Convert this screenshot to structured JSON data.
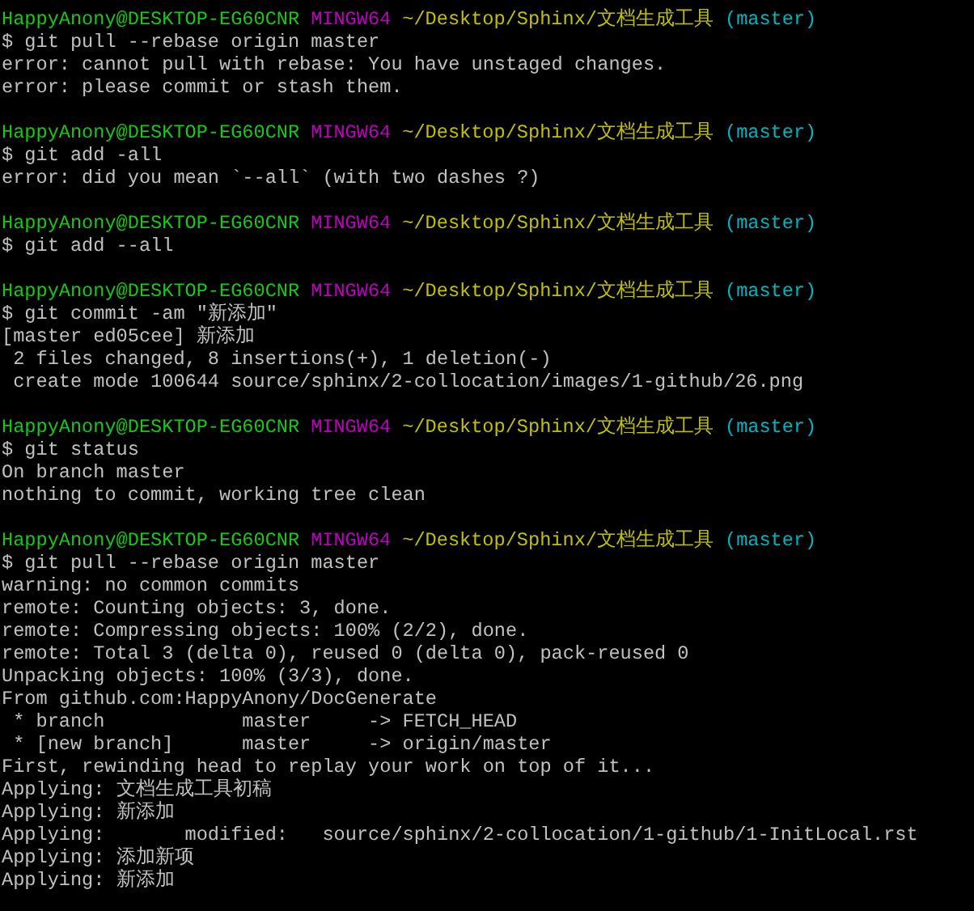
{
  "terminal": {
    "blocks": [
      {
        "prompt": {
          "user": "HappyAnony@DESKTOP-EG60CNR",
          "system": "MINGW64",
          "path": "~/Desktop/Sphinx/文档生成工具",
          "branch": "(master)"
        },
        "command": "$ git pull --rebase origin master",
        "output": [
          "error: cannot pull with rebase: You have unstaged changes.",
          "error: please commit or stash them."
        ]
      },
      {
        "prompt": {
          "user": "HappyAnony@DESKTOP-EG60CNR",
          "system": "MINGW64",
          "path": "~/Desktop/Sphinx/文档生成工具",
          "branch": "(master)"
        },
        "command": "$ git add -all",
        "output": [
          "error: did you mean `--all` (with two dashes ?)"
        ]
      },
      {
        "prompt": {
          "user": "HappyAnony@DESKTOP-EG60CNR",
          "system": "MINGW64",
          "path": "~/Desktop/Sphinx/文档生成工具",
          "branch": "(master)"
        },
        "command": "$ git add --all"
      },
      {
        "prompt": {
          "user": "HappyAnony@DESKTOP-EG60CNR",
          "system": "MINGW64",
          "path": "~/Desktop/Sphinx/文档生成工具",
          "branch": "(master)"
        },
        "command": "$ git commit -am \"新添加\"",
        "output": [
          "[master ed05cee] 新添加",
          " 2 files changed, 8 insertions(+), 1 deletion(-)",
          " create mode 100644 source/sphinx/2-collocation/images/1-github/26.png"
        ]
      },
      {
        "prompt": {
          "user": "HappyAnony@DESKTOP-EG60CNR",
          "system": "MINGW64",
          "path": "~/Desktop/Sphinx/文档生成工具",
          "branch": "(master)"
        },
        "command": "$ git status",
        "output": [
          "On branch master",
          "nothing to commit, working tree clean"
        ]
      },
      {
        "prompt": {
          "user": "HappyAnony@DESKTOP-EG60CNR",
          "system": "MINGW64",
          "path": "~/Desktop/Sphinx/文档生成工具",
          "branch": "(master)"
        },
        "command": "$ git pull --rebase origin master",
        "output": [
          "warning: no common commits",
          "remote: Counting objects: 3, done.",
          "remote: Compressing objects: 100% (2/2), done.",
          "remote: Total 3 (delta 0), reused 0 (delta 0), pack-reused 0",
          "Unpacking objects: 100% (3/3), done.",
          "From github.com:HappyAnony/DocGenerate",
          " * branch            master     -> FETCH_HEAD",
          " * [new branch]      master     -> origin/master",
          "First, rewinding head to replay your work on top of it...",
          "Applying: 文档生成工具初稿",
          "Applying: 新添加",
          "Applying:       modified:   source/sphinx/2-collocation/1-github/1-InitLocal.rst",
          "Applying: 添加新项",
          "Applying: 新添加"
        ]
      }
    ]
  }
}
